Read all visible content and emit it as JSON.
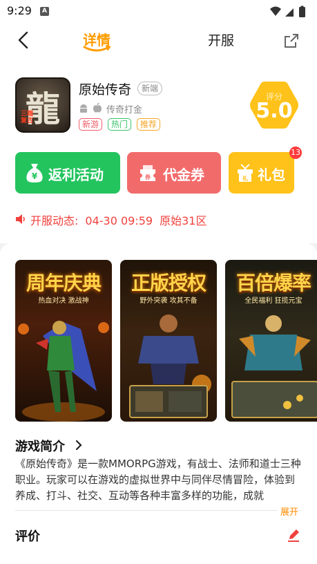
{
  "status_bar": {
    "time": "9:29",
    "notif_icon": "A"
  },
  "nav": {
    "tab_detail": "详情",
    "tab_server": "开服",
    "back_icon": "chevron-left-icon",
    "share_icon": "share-icon"
  },
  "game": {
    "name": "原始传奇",
    "badge": "新端",
    "category": "传奇打金",
    "icon_glyph": "龍",
    "icon_sub": "三端复古",
    "tags": [
      "新游",
      "热门",
      "推荐"
    ],
    "score_label": "评分",
    "score": "5.0"
  },
  "actions": {
    "rebate": "返利活动",
    "voucher": "代金券",
    "gift": "礼包",
    "gift_count": "13"
  },
  "notice": {
    "prefix": "开服动态:",
    "datetime": "04-30 09:59",
    "server": "原始31区"
  },
  "screenshots": [
    {
      "title": "周年庆典",
      "subtitle": "热血对决 激战神"
    },
    {
      "title": "正版授权",
      "subtitle": "野外突袭 攻其不备"
    },
    {
      "title": "百倍爆率",
      "subtitle": "全民福利 狂揽元宝"
    }
  ],
  "intro": {
    "title": "游戏简介",
    "body": "《原始传奇》是一款MMORPG游戏，有战士、法师和道士三种职业。玩家可以在游戏的虚拟世界中与同伴尽情冒险，体验到养成、打斗、社交、互动等各种丰富多样的功能，成就",
    "expand": "展开"
  },
  "review": {
    "title": "评价"
  },
  "colors": {
    "accent": "#ff9c00",
    "rebate": "#23c45e",
    "voucher": "#f26b6b",
    "gift": "#ffc21a",
    "notice": "#f0413c",
    "score": "#ffc21a"
  }
}
